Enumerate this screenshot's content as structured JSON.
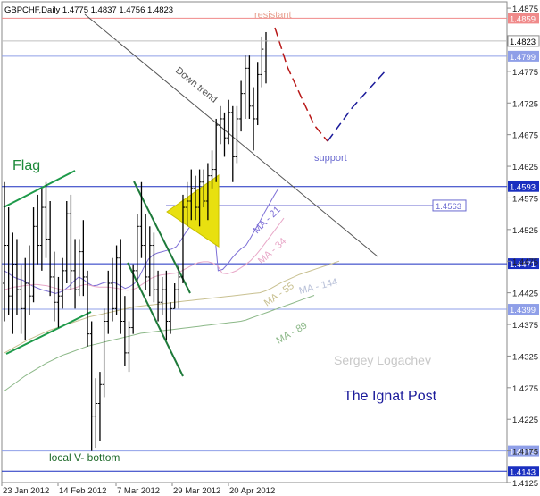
{
  "chart_data": {
    "type": "ohlc",
    "header": "GBPCHF,Daily  1.4775 1.4837 1.4756 1.4823",
    "symbol": "GBPCHF",
    "timeframe": "Daily",
    "ohlc_last": {
      "open": 1.4775,
      "high": 1.4837,
      "low": 1.4756,
      "close": 1.4823
    },
    "ylim": [
      1.4125,
      1.4885
    ],
    "yticks": [
      "1.4875",
      "1.4823",
      "1.4775",
      "1.4725",
      "1.4675",
      "1.4625",
      "1.4575",
      "1.4525",
      "1.4475",
      "1.4425",
      "1.4375",
      "1.4325",
      "1.4275",
      "1.4225",
      "1.4175",
      "1.4125"
    ],
    "xticks": [
      "23 Jan 2012",
      "14 Feb 2012",
      "7 Mar 2012",
      "29 Mar 2012",
      "20 Apr 2012"
    ],
    "horizontal_levels": [
      {
        "value": 1.4859,
        "label": "1.4859",
        "color": "#f08a8a"
      },
      {
        "value": 1.4799,
        "label": "1.4799",
        "color": "#8f9fe8"
      },
      {
        "value": 1.4593,
        "label": "1.4593",
        "color": "#1a2fc0"
      },
      {
        "value": 1.4563,
        "label": "1.4563",
        "color": "#6a6ad0"
      },
      {
        "value": 1.4471,
        "label": "1.4471",
        "color": "#1a2fc0"
      },
      {
        "value": 1.4399,
        "label": "1.4399",
        "color": "#8f9fe8"
      },
      {
        "value": 1.4175,
        "label": "1.4175",
        "color": "#8f9fe8"
      },
      {
        "value": 1.4143,
        "label": "1.4143",
        "color": "#1a2fc0"
      }
    ],
    "moving_averages": [
      {
        "name": "MA - 21",
        "color": "#7d6fd6",
        "values": [
          1.446,
          1.4455,
          1.445,
          1.4447,
          1.4445,
          1.444,
          1.4436,
          1.4433,
          1.443,
          1.4428,
          1.4426,
          1.4424,
          1.4426,
          1.443,
          1.4436,
          1.4444,
          1.445,
          1.4446,
          1.444,
          1.4436,
          1.4437,
          1.444,
          1.4442,
          1.4442,
          1.444,
          1.4436,
          1.4432,
          1.4435,
          1.444,
          1.445,
          1.4465,
          1.4478,
          1.4485,
          1.4488,
          1.449,
          1.4492,
          1.4494,
          1.4498,
          1.4508,
          1.452,
          1.453,
          1.4538,
          1.4543,
          1.4545,
          1.4545,
          1.454,
          1.446,
          1.4462,
          1.447,
          1.448,
          1.4488,
          1.4495,
          1.45,
          1.4512,
          1.4525,
          1.4538,
          1.4552,
          1.4565,
          1.4578,
          1.459
        ]
      },
      {
        "name": "MA - 34",
        "color": "#e8a8c8",
        "values": [
          1.443,
          1.4432,
          1.4434,
          1.4435,
          1.4436,
          1.4437,
          1.4438,
          1.4438,
          1.4437,
          1.4436,
          1.4434,
          1.4432,
          1.443,
          1.443,
          1.4431,
          1.4433,
          1.4436,
          1.4438,
          1.4437,
          1.4435,
          1.4434,
          1.4434,
          1.4434,
          1.4433,
          1.4432,
          1.443,
          1.4429,
          1.443,
          1.4433,
          1.4438,
          1.4443,
          1.4448,
          1.4451,
          1.4453,
          1.4454,
          1.4455,
          1.4456,
          1.4458,
          1.4462,
          1.4466,
          1.447,
          1.4473,
          1.4474,
          1.4474,
          1.4472,
          1.4468,
          1.4456,
          1.4455,
          1.4457,
          1.446,
          1.4465,
          1.447,
          1.4476,
          1.4484,
          1.4493,
          1.4503,
          1.4513,
          1.4523,
          1.4533,
          1.4543
        ]
      },
      {
        "name": "MA - 55",
        "color": "#c8c090",
        "values": [
          1.433,
          1.4335,
          1.434,
          1.4345,
          1.435,
          1.4354,
          1.4358,
          1.4362,
          1.4366,
          1.4369,
          1.4372,
          1.4375,
          1.4378,
          1.4381,
          1.4384,
          1.4387,
          1.4389,
          1.4391,
          1.4393,
          1.4395,
          1.4397,
          1.4399,
          1.4401,
          1.4403,
          1.4404,
          1.4405,
          1.4406,
          1.4407,
          1.4408,
          1.4409,
          1.441,
          1.4411,
          1.4412,
          1.4413,
          1.4414,
          1.4415,
          1.4416,
          1.4417,
          1.4418,
          1.4419,
          1.442,
          1.4421,
          1.4422,
          1.4423,
          1.4424,
          1.4425,
          1.4428,
          1.4432,
          1.4437,
          1.4442,
          1.4446,
          1.445,
          1.4454,
          1.4457,
          1.446,
          1.4463,
          1.4466,
          1.4469,
          1.4472,
          1.4475
        ]
      },
      {
        "name": "MA - 89",
        "color": "#8cb888",
        "values": [
          1.427,
          1.4276,
          1.4282,
          1.4288,
          1.4294,
          1.4299,
          1.4304,
          1.4309,
          1.4314,
          1.4318,
          1.4322,
          1.4326,
          1.4329,
          1.4332,
          1.4335,
          1.4338,
          1.4341,
          1.4343,
          1.4345,
          1.4347,
          1.4349,
          1.4351,
          1.4353,
          1.4355,
          1.4357,
          1.4359,
          1.4361,
          1.4362,
          1.4363,
          1.4364,
          1.4365,
          1.4366,
          1.4367,
          1.4368,
          1.4369,
          1.437,
          1.4371,
          1.4372,
          1.4373,
          1.4374,
          1.4375,
          1.4376,
          1.4377,
          1.4378,
          1.4379,
          1.438,
          1.4382,
          1.4385,
          1.4388,
          1.4391,
          1.4394,
          1.4397,
          1.44,
          1.4403,
          1.4406,
          1.4409,
          1.4412,
          1.4415,
          1.4418,
          1.4421
        ]
      },
      {
        "name": "MA - 144",
        "color": "#b8c0d8",
        "values": []
      }
    ],
    "bars": [
      {
        "o": 1.444,
        "h": 1.46,
        "l": 1.438,
        "c": 1.45
      },
      {
        "o": 1.45,
        "h": 1.456,
        "l": 1.439,
        "c": 1.442
      },
      {
        "o": 1.442,
        "h": 1.452,
        "l": 1.436,
        "c": 1.447
      },
      {
        "o": 1.447,
        "h": 1.451,
        "l": 1.439,
        "c": 1.443
      },
      {
        "o": 1.443,
        "h": 1.447,
        "l": 1.436,
        "c": 1.44
      },
      {
        "o": 1.44,
        "h": 1.448,
        "l": 1.435,
        "c": 1.444
      },
      {
        "o": 1.444,
        "h": 1.45,
        "l": 1.439,
        "c": 1.442
      },
      {
        "o": 1.442,
        "h": 1.456,
        "l": 1.441,
        "c": 1.453
      },
      {
        "o": 1.453,
        "h": 1.458,
        "l": 1.447,
        "c": 1.45
      },
      {
        "o": 1.45,
        "h": 1.459,
        "l": 1.446,
        "c": 1.456
      },
      {
        "o": 1.456,
        "h": 1.46,
        "l": 1.448,
        "c": 1.451
      },
      {
        "o": 1.451,
        "h": 1.457,
        "l": 1.442,
        "c": 1.445
      },
      {
        "o": 1.445,
        "h": 1.449,
        "l": 1.438,
        "c": 1.441
      },
      {
        "o": 1.441,
        "h": 1.445,
        "l": 1.437,
        "c": 1.442
      },
      {
        "o": 1.442,
        "h": 1.448,
        "l": 1.44,
        "c": 1.446
      },
      {
        "o": 1.446,
        "h": 1.457,
        "l": 1.444,
        "c": 1.455
      },
      {
        "o": 1.455,
        "h": 1.458,
        "l": 1.443,
        "c": 1.446
      },
      {
        "o": 1.446,
        "h": 1.451,
        "l": 1.44,
        "c": 1.443
      },
      {
        "o": 1.443,
        "h": 1.451,
        "l": 1.442,
        "c": 1.449
      },
      {
        "o": 1.449,
        "h": 1.454,
        "l": 1.442,
        "c": 1.445
      },
      {
        "o": 1.445,
        "h": 1.446,
        "l": 1.434,
        "c": 1.436
      },
      {
        "o": 1.436,
        "h": 1.438,
        "l": 1.4175,
        "c": 1.423
      },
      {
        "o": 1.423,
        "h": 1.429,
        "l": 1.418,
        "c": 1.425
      },
      {
        "o": 1.425,
        "h": 1.43,
        "l": 1.419,
        "c": 1.428
      },
      {
        "o": 1.428,
        "h": 1.44,
        "l": 1.426,
        "c": 1.438
      },
      {
        "o": 1.438,
        "h": 1.446,
        "l": 1.436,
        "c": 1.444
      },
      {
        "o": 1.444,
        "h": 1.448,
        "l": 1.438,
        "c": 1.44
      },
      {
        "o": 1.44,
        "h": 1.45,
        "l": 1.439,
        "c": 1.448
      },
      {
        "o": 1.448,
        "h": 1.451,
        "l": 1.436,
        "c": 1.438
      },
      {
        "o": 1.438,
        "h": 1.442,
        "l": 1.431,
        "c": 1.433
      },
      {
        "o": 1.433,
        "h": 1.438,
        "l": 1.43,
        "c": 1.437
      },
      {
        "o": 1.437,
        "h": 1.447,
        "l": 1.436,
        "c": 1.446
      },
      {
        "o": 1.446,
        "h": 1.455,
        "l": 1.444,
        "c": 1.453
      },
      {
        "o": 1.453,
        "h": 1.46,
        "l": 1.448,
        "c": 1.45
      },
      {
        "o": 1.45,
        "h": 1.455,
        "l": 1.443,
        "c": 1.445
      },
      {
        "o": 1.445,
        "h": 1.453,
        "l": 1.442,
        "c": 1.45
      },
      {
        "o": 1.45,
        "h": 1.452,
        "l": 1.441,
        "c": 1.443
      },
      {
        "o": 1.443,
        "h": 1.446,
        "l": 1.438,
        "c": 1.441
      },
      {
        "o": 1.441,
        "h": 1.445,
        "l": 1.439,
        "c": 1.443
      },
      {
        "o": 1.443,
        "h": 1.446,
        "l": 1.435,
        "c": 1.438
      },
      {
        "o": 1.438,
        "h": 1.441,
        "l": 1.436,
        "c": 1.44
      },
      {
        "o": 1.44,
        "h": 1.444,
        "l": 1.44,
        "c": 1.443
      },
      {
        "o": 1.443,
        "h": 1.447,
        "l": 1.44,
        "c": 1.445
      },
      {
        "o": 1.445,
        "h": 1.458,
        "l": 1.444,
        "c": 1.456
      },
      {
        "o": 1.456,
        "h": 1.46,
        "l": 1.453,
        "c": 1.457
      },
      {
        "o": 1.457,
        "h": 1.462,
        "l": 1.454,
        "c": 1.459
      },
      {
        "o": 1.459,
        "h": 1.461,
        "l": 1.454,
        "c": 1.456
      },
      {
        "o": 1.456,
        "h": 1.462,
        "l": 1.453,
        "c": 1.46
      },
      {
        "o": 1.46,
        "h": 1.462,
        "l": 1.456,
        "c": 1.457
      },
      {
        "o": 1.457,
        "h": 1.463,
        "l": 1.454,
        "c": 1.461
      },
      {
        "o": 1.461,
        "h": 1.465,
        "l": 1.459,
        "c": 1.462
      },
      {
        "o": 1.462,
        "h": 1.47,
        "l": 1.46,
        "c": 1.469
      },
      {
        "o": 1.469,
        "h": 1.472,
        "l": 1.466,
        "c": 1.47
      },
      {
        "o": 1.47,
        "h": 1.471,
        "l": 1.464,
        "c": 1.467
      },
      {
        "o": 1.467,
        "h": 1.473,
        "l": 1.466,
        "c": 1.471
      },
      {
        "o": 1.471,
        "h": 1.472,
        "l": 1.46,
        "c": 1.464
      },
      {
        "o": 1.464,
        "h": 1.472,
        "l": 1.463,
        "c": 1.47
      },
      {
        "o": 1.47,
        "h": 1.476,
        "l": 1.468,
        "c": 1.474
      },
      {
        "o": 1.474,
        "h": 1.48,
        "l": 1.47,
        "c": 1.478
      },
      {
        "o": 1.478,
        "h": 1.48,
        "l": 1.47,
        "c": 1.472
      },
      {
        "o": 1.472,
        "h": 1.475,
        "l": 1.465,
        "c": 1.47
      },
      {
        "o": 1.47,
        "h": 1.479,
        "l": 1.469,
        "c": 1.477
      },
      {
        "o": 1.477,
        "h": 1.483,
        "l": 1.475,
        "c": 1.481
      },
      {
        "o": 1.4775,
        "h": 1.4837,
        "l": 1.4756,
        "c": 1.4823
      }
    ],
    "annotations": [
      "resistant",
      "support",
      "Down trend",
      "Flag",
      "local V- bottom",
      "MA - 21",
      "MA - 34",
      "MA - 55",
      "MA - 144",
      "MA - 89",
      "Sergey Logachev",
      "The Ignat Post"
    ],
    "current_price_label": "1.4823"
  },
  "labels": {
    "resistant": "resistant",
    "support": "support",
    "down_trend": "Down trend",
    "flag": "Flag",
    "local_v_bottom": "local V- bottom",
    "author": "Sergey Logachev",
    "publisher": "The Ignat Post"
  }
}
